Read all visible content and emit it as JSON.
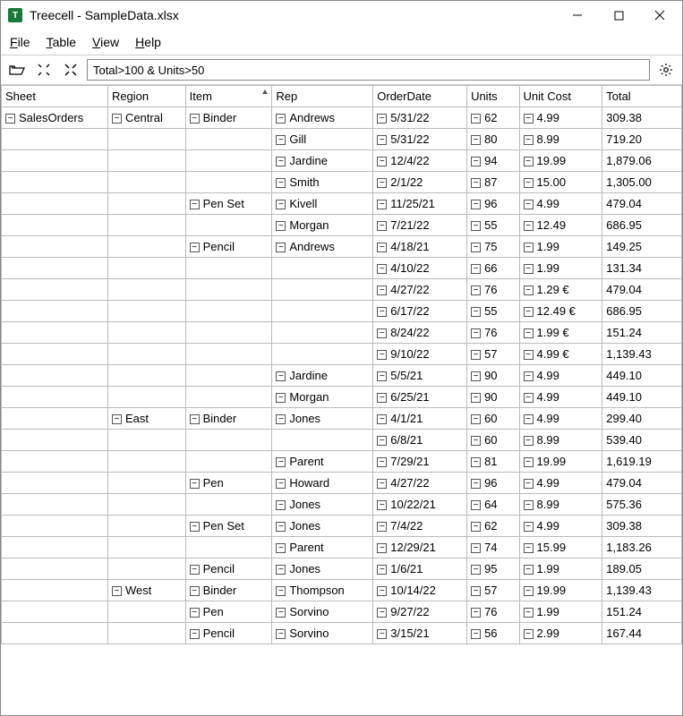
{
  "window": {
    "title": "Treecell - SampleData.xlsx"
  },
  "menu": {
    "file": "File",
    "table": "Table",
    "view": "View",
    "help": "Help"
  },
  "toolbar": {
    "filter_value": "Total>100 & Units>50"
  },
  "columns": {
    "sheet": "Sheet",
    "region": "Region",
    "item": "Item",
    "rep": "Rep",
    "orderdate": "OrderDate",
    "units": "Units",
    "unitcost": "Unit Cost",
    "total": "Total"
  },
  "rows": [
    {
      "sheet": "SalesOrders",
      "region": "Central",
      "item": "Binder",
      "rep": "Andrews",
      "date": "5/31/22",
      "units": "62",
      "cost": "4.99",
      "total": "309.38"
    },
    {
      "sheet": "",
      "region": "",
      "item": "",
      "rep": "Gill",
      "date": "5/31/22",
      "units": "80",
      "cost": "8.99",
      "total": "719.20"
    },
    {
      "sheet": "",
      "region": "",
      "item": "",
      "rep": "Jardine",
      "date": "12/4/22",
      "units": "94",
      "cost": "19.99",
      "total": "1,879.06"
    },
    {
      "sheet": "",
      "region": "",
      "item": "",
      "rep": "Smith",
      "date": "2/1/22",
      "units": "87",
      "cost": "15.00",
      "total": "1,305.00"
    },
    {
      "sheet": "",
      "region": "",
      "item": "Pen Set",
      "rep": "Kivell",
      "date": "11/25/21",
      "units": "96",
      "cost": "4.99",
      "total": "479.04"
    },
    {
      "sheet": "",
      "region": "",
      "item": "",
      "rep": "Morgan",
      "date": "7/21/22",
      "units": "55",
      "cost": "12.49",
      "total": "686.95"
    },
    {
      "sheet": "",
      "region": "",
      "item": "Pencil",
      "rep": "Andrews",
      "date": "4/18/21",
      "units": "75",
      "cost": "1.99",
      "total": "149.25"
    },
    {
      "sheet": "",
      "region": "",
      "item": "",
      "rep": "",
      "date": "4/10/22",
      "units": "66",
      "cost": "1.99",
      "total": "131.34"
    },
    {
      "sheet": "",
      "region": "",
      "item": "",
      "rep": "",
      "date": "4/27/22",
      "units": "76",
      "cost": "1.29 €",
      "total": "479.04"
    },
    {
      "sheet": "",
      "region": "",
      "item": "",
      "rep": "",
      "date": "6/17/22",
      "units": "55",
      "cost": "12.49 €",
      "total": "686.95"
    },
    {
      "sheet": "",
      "region": "",
      "item": "",
      "rep": "",
      "date": "8/24/22",
      "units": "76",
      "cost": "1.99 €",
      "total": "151.24"
    },
    {
      "sheet": "",
      "region": "",
      "item": "",
      "rep": "",
      "date": "9/10/22",
      "units": "57",
      "cost": "4.99 €",
      "total": "1,139.43"
    },
    {
      "sheet": "",
      "region": "",
      "item": "",
      "rep": "Jardine",
      "date": "5/5/21",
      "units": "90",
      "cost": "4.99",
      "total": "449.10"
    },
    {
      "sheet": "",
      "region": "",
      "item": "",
      "rep": "Morgan",
      "date": "6/25/21",
      "units": "90",
      "cost": "4.99",
      "total": "449.10"
    },
    {
      "sheet": "",
      "region": "East",
      "item": "Binder",
      "rep": "Jones",
      "date": "4/1/21",
      "units": "60",
      "cost": "4.99",
      "total": "299.40"
    },
    {
      "sheet": "",
      "region": "",
      "item": "",
      "rep": "",
      "date": "6/8/21",
      "units": "60",
      "cost": "8.99",
      "total": "539.40"
    },
    {
      "sheet": "",
      "region": "",
      "item": "",
      "rep": "Parent",
      "date": "7/29/21",
      "units": "81",
      "cost": "19.99",
      "total": "1,619.19"
    },
    {
      "sheet": "",
      "region": "",
      "item": "Pen",
      "rep": "Howard",
      "date": "4/27/22",
      "units": "96",
      "cost": "4.99",
      "total": "479.04"
    },
    {
      "sheet": "",
      "region": "",
      "item": "",
      "rep": "Jones",
      "date": "10/22/21",
      "units": "64",
      "cost": "8.99",
      "total": "575.36"
    },
    {
      "sheet": "",
      "region": "",
      "item": "Pen Set",
      "rep": "Jones",
      "date": "7/4/22",
      "units": "62",
      "cost": "4.99",
      "total": "309.38"
    },
    {
      "sheet": "",
      "region": "",
      "item": "",
      "rep": "Parent",
      "date": "12/29/21",
      "units": "74",
      "cost": "15.99",
      "total": "1,183.26"
    },
    {
      "sheet": "",
      "region": "",
      "item": "Pencil",
      "rep": "Jones",
      "date": "1/6/21",
      "units": "95",
      "cost": "1.99",
      "total": "189.05"
    },
    {
      "sheet": "",
      "region": "West",
      "item": "Binder",
      "rep": "Thompson",
      "date": "10/14/22",
      "units": "57",
      "cost": "19.99",
      "total": "1,139.43"
    },
    {
      "sheet": "",
      "region": "",
      "item": "Pen",
      "rep": "Sorvino",
      "date": "9/27/22",
      "units": "76",
      "cost": "1.99",
      "total": "151.24"
    },
    {
      "sheet": "",
      "region": "",
      "item": "Pencil",
      "rep": "Sorvino",
      "date": "3/15/21",
      "units": "56",
      "cost": "2.99",
      "total": "167.44"
    }
  ]
}
